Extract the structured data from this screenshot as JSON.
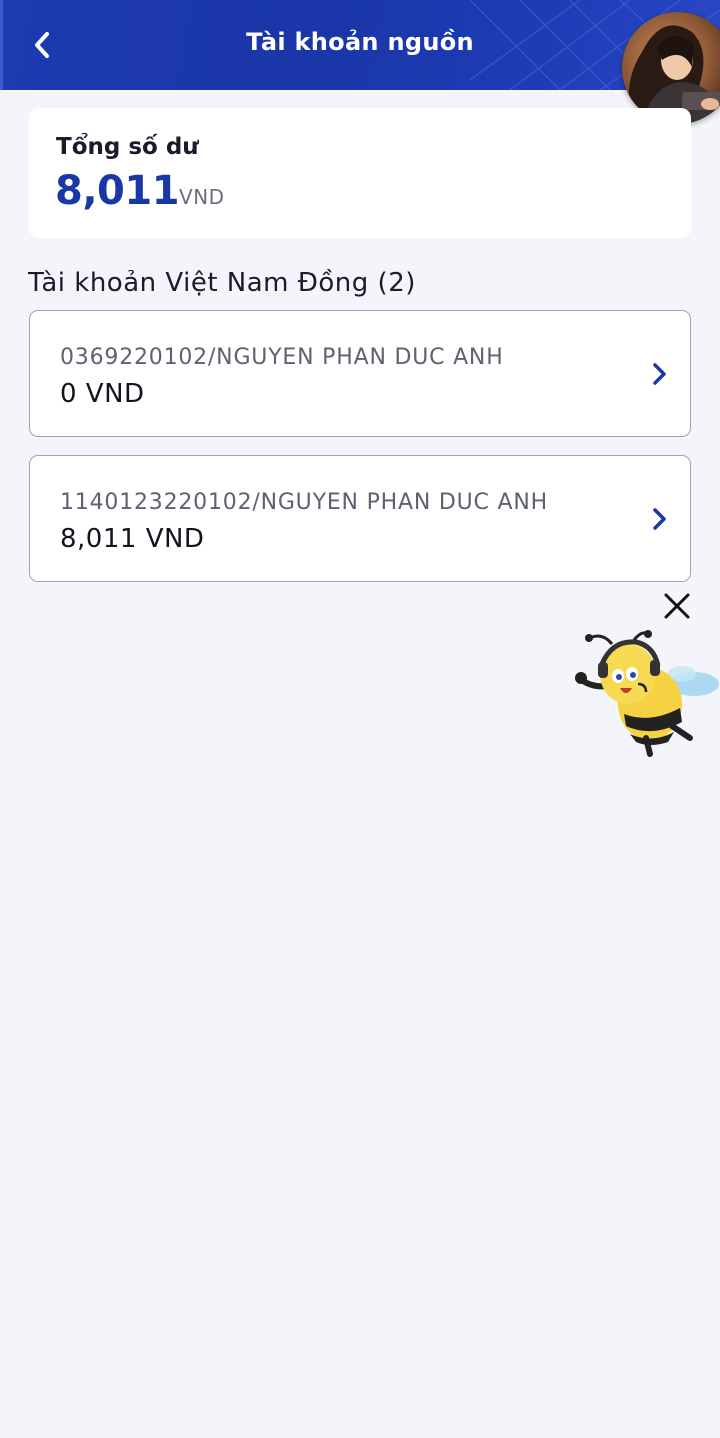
{
  "header": {
    "title": "Tài khoản nguồn",
    "back_icon": "chevron-left-icon",
    "avatar_icon": "user-avatar"
  },
  "balance": {
    "label": "Tổng số dư",
    "amount": "8,011",
    "currency": "VND"
  },
  "section": {
    "title": "Tài khoản Việt Nam Đồng (2)"
  },
  "accounts": [
    {
      "name": "0369220102/NGUYEN PHAN DUC ANH",
      "balance": "0 VND"
    },
    {
      "name": "1140123220102/NGUYEN PHAN DUC ANH",
      "balance": "8,011 VND"
    }
  ],
  "assistant": {
    "close_icon": "close-icon",
    "mascot_icon": "bee-mascot-icon"
  },
  "colors": {
    "brand_blue": "#1a37a6",
    "header_blue": "#1d3ab0",
    "background": "#f3f5fa"
  }
}
